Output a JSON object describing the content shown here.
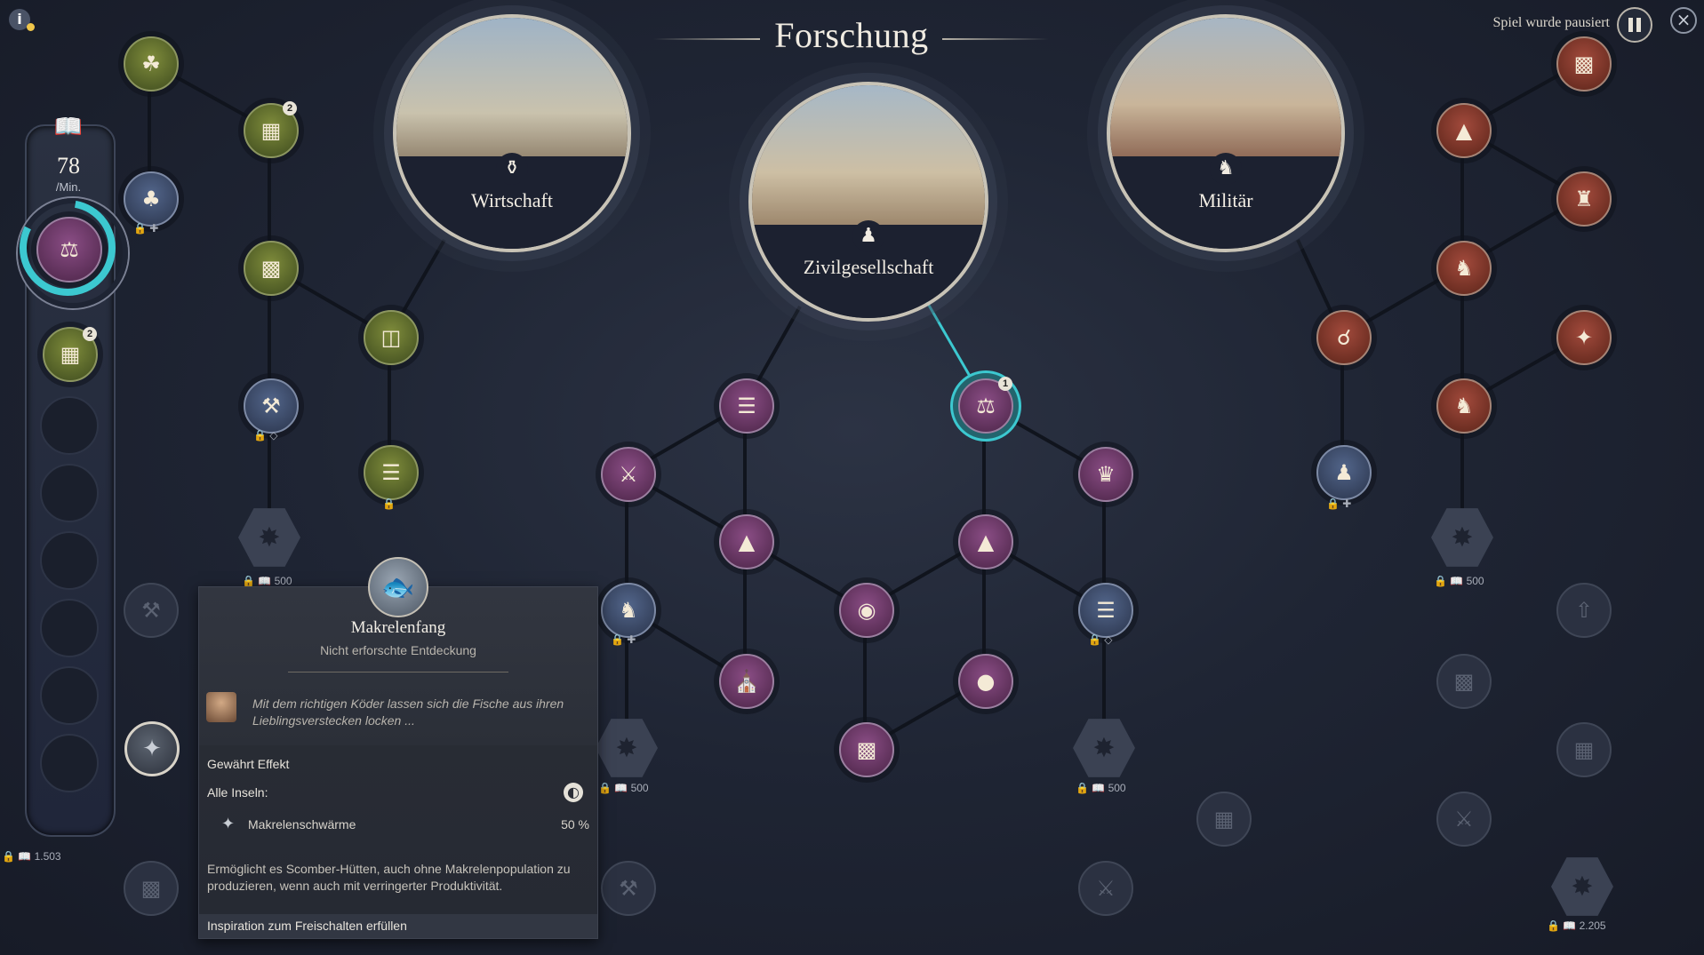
{
  "header": {
    "title": "Forschung",
    "paused_label": "Spiel wurde pausiert"
  },
  "left_panel": {
    "rate_value": "78",
    "rate_unit": "/Min.",
    "queue_badge": "2"
  },
  "branches": {
    "economy": "Wirtschaft",
    "civil": "Zivilgesellschaft",
    "military": "Militär"
  },
  "badges": {
    "top_left_node": "2",
    "active_node": "1"
  },
  "locks": {
    "cost_500": "500",
    "cost_1503": "1.503",
    "cost_2205": "2.205"
  },
  "tooltip": {
    "title": "Makrelenfang",
    "subtitle": "Nicht erforschte Entdeckung",
    "quote": "Mit dem richtigen Köder lassen sich die Fische aus ihren Lieblingsverstecken locken ...",
    "effect_heading": "Gewährt Effekt",
    "scope": "Alle Inseln:",
    "effect_label": "Makrelenschwärme",
    "effect_value": "50 %",
    "description": "Ermöglicht es Scomber-Hütten, auch ohne Makrelenpopulation zu produzieren, wenn auch mit verringerter Produktivität.",
    "footer": "Inspiration zum Freischalten erfüllen"
  },
  "colors": {
    "accent_cyan": "#3cc8d0",
    "civil_purple": "#6b3766",
    "economy_green": "#5d6a2c",
    "military_red": "#7a3428"
  }
}
